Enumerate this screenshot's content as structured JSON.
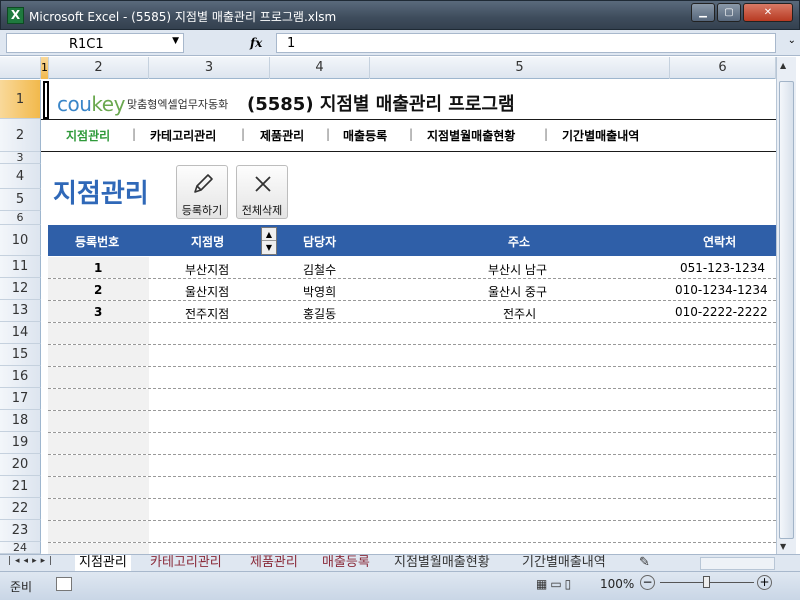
{
  "window": {
    "app_icon": "X",
    "title": "Microsoft Excel - (5585) 지점별 매출관리 프로그램.xlsm"
  },
  "formula_bar": {
    "name_box": "R1C1",
    "fx_label": "fx",
    "value": "1"
  },
  "columns": [
    "1",
    "2",
    "3",
    "4",
    "5",
    "6"
  ],
  "rows": [
    "1",
    "2",
    "3",
    "4",
    "5",
    "6",
    "10",
    "11",
    "12",
    "13",
    "14",
    "15",
    "16",
    "17",
    "18",
    "19",
    "20",
    "21",
    "22",
    "23",
    "24"
  ],
  "header": {
    "logo_co": "cou",
    "logo_key": "key",
    "slogan": "맞춤형엑셀업무자동화",
    "title": "(5585) 지점별 매출관리 프로그램"
  },
  "nav": {
    "items": [
      "지점관리",
      "카테고리관리",
      "제품관리",
      "매출등록",
      "지점별월매출현황",
      "기간별매출내역"
    ],
    "separator": "|",
    "active_index": 0
  },
  "page": {
    "title": "지점관리",
    "register_label": "등록하기",
    "delete_all_label": "전체삭제"
  },
  "table": {
    "headers": [
      "등록번호",
      "지점명",
      "담당자",
      "주소",
      "연락처"
    ],
    "rows": [
      [
        "1",
        "부산지점",
        "김철수",
        "부산시 남구",
        "051-123-1234"
      ],
      [
        "2",
        "울산지점",
        "박영희",
        "울산시 중구",
        "010-1234-1234"
      ],
      [
        "3",
        "전주지점",
        "홍길동",
        "전주시",
        "010-2222-2222"
      ]
    ]
  },
  "sheet_tabs": [
    "지점관리",
    "카테고리관리",
    "제품관리",
    "매출등록",
    "지점별월매출현황",
    "기간별매출내역"
  ],
  "status": {
    "ready": "준비",
    "zoom": "100%"
  },
  "colors": {
    "table_header": "#2f5fa8",
    "page_title": "#2f68b8",
    "nav_active": "#2f9a3a"
  }
}
